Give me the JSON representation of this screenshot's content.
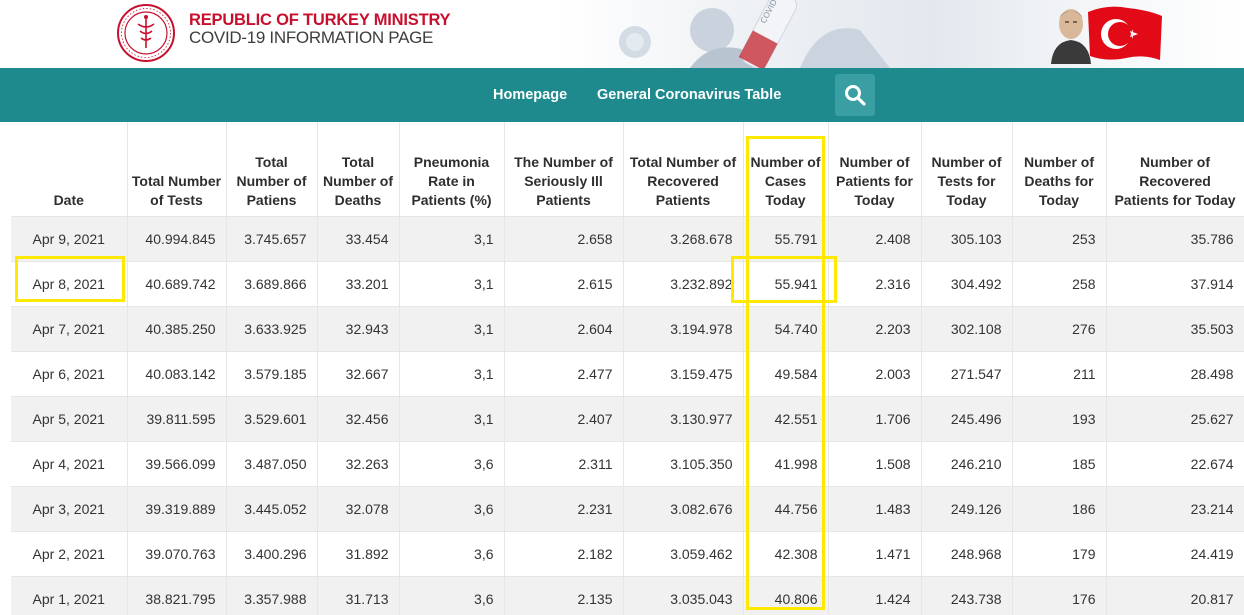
{
  "header": {
    "org_line1": "REPUBLIC OF TURKEY MINISTRY",
    "org_line2": "COVID-19 INFORMATION PAGE",
    "tube_label": "COVID-19"
  },
  "nav": {
    "home": "Homepage",
    "table": "General Coronavirus Table"
  },
  "colors": {
    "nav_bg": "#1e8a8e",
    "brand_red": "#c8102e",
    "highlight": "#ffe900"
  },
  "table": {
    "columns": [
      "Date",
      "Total Number of Tests",
      "Total Number of Patiens",
      "Total Number of Deaths",
      "Pneumonia Rate in Patients (%)",
      "The Number of Seriously Ill Patients",
      "Total Number of Recovered Patients",
      "Number of Cases Today",
      "Number of Patients for Today",
      "Number of Tests for Today",
      "Number of Deaths for Today",
      "Number of Recovered Patients for Today"
    ],
    "rows": [
      [
        "Apr 9, 2021",
        "40.994.845",
        "3.745.657",
        "33.454",
        "3,1",
        "2.658",
        "3.268.678",
        "55.791",
        "2.408",
        "305.103",
        "253",
        "35.786"
      ],
      [
        "Apr 8, 2021",
        "40.689.742",
        "3.689.866",
        "33.201",
        "3,1",
        "2.615",
        "3.232.892",
        "55.941",
        "2.316",
        "304.492",
        "258",
        "37.914"
      ],
      [
        "Apr 7, 2021",
        "40.385.250",
        "3.633.925",
        "32.943",
        "3,1",
        "2.604",
        "3.194.978",
        "54.740",
        "2.203",
        "302.108",
        "276",
        "35.503"
      ],
      [
        "Apr 6, 2021",
        "40.083.142",
        "3.579.185",
        "32.667",
        "3,1",
        "2.477",
        "3.159.475",
        "49.584",
        "2.003",
        "271.547",
        "211",
        "28.498"
      ],
      [
        "Apr 5, 2021",
        "39.811.595",
        "3.529.601",
        "32.456",
        "3,1",
        "2.407",
        "3.130.977",
        "42.551",
        "1.706",
        "245.496",
        "193",
        "25.627"
      ],
      [
        "Apr 4, 2021",
        "39.566.099",
        "3.487.050",
        "32.263",
        "3,6",
        "2.311",
        "3.105.350",
        "41.998",
        "1.508",
        "246.210",
        "185",
        "22.674"
      ],
      [
        "Apr 3, 2021",
        "39.319.889",
        "3.445.052",
        "32.078",
        "3,6",
        "2.231",
        "3.082.676",
        "44.756",
        "1.483",
        "249.126",
        "186",
        "23.214"
      ],
      [
        "Apr 2, 2021",
        "39.070.763",
        "3.400.296",
        "31.892",
        "3,6",
        "2.182",
        "3.059.462",
        "42.308",
        "1.471",
        "248.968",
        "179",
        "24.419"
      ],
      [
        "Apr 1, 2021",
        "38.821.795",
        "3.357.988",
        "31.713",
        "3,6",
        "2.135",
        "3.035.043",
        "40.806",
        "1.424",
        "243.738",
        "176",
        "20.817"
      ]
    ]
  }
}
